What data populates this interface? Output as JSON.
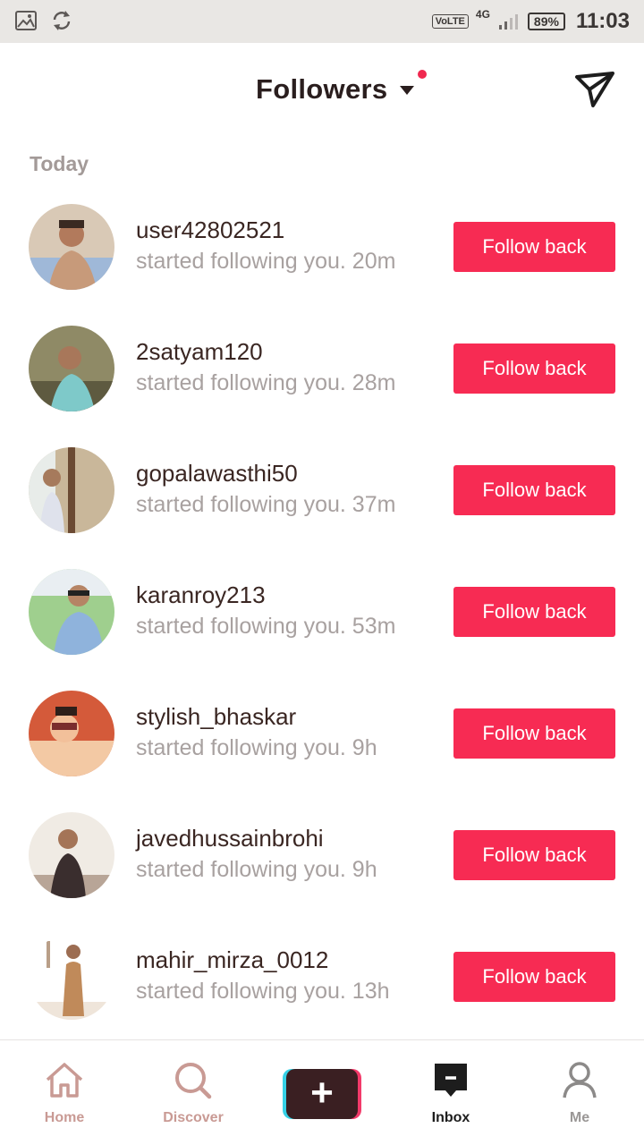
{
  "status_bar": {
    "volte": "VoLTE",
    "network": "4G",
    "battery": "89%",
    "time": "11:03"
  },
  "header": {
    "title": "Followers",
    "dropdown_icon": "caret-down-icon",
    "action_icon": "send-icon",
    "notification_color": "#f0284f"
  },
  "section_label": "Today",
  "followers": [
    {
      "username": "user42802521",
      "activity": "started following you. 20m",
      "button": "Follow back"
    },
    {
      "username": "2satyam120",
      "activity": "started following you. 28m",
      "button": "Follow back"
    },
    {
      "username": "gopalawasthi50",
      "activity": "started following you. 37m",
      "button": "Follow back"
    },
    {
      "username": "karanroy213",
      "activity": "started following you. 53m",
      "button": "Follow back"
    },
    {
      "username": "stylish_bhaskar",
      "activity": "started following you. 9h",
      "button": "Follow back"
    },
    {
      "username": "javedhussainbrohi",
      "activity": "started following you. 9h",
      "button": "Follow back"
    },
    {
      "username": "mahir_mirza_0012",
      "activity": "started following you. 13h",
      "button": "Follow back"
    }
  ],
  "nav": {
    "home": "Home",
    "discover": "Discover",
    "create": "+",
    "inbox": "Inbox",
    "me": "Me",
    "active": "Inbox"
  },
  "colors": {
    "accent": "#f72b53",
    "inactive_nav": "#c99a94"
  }
}
